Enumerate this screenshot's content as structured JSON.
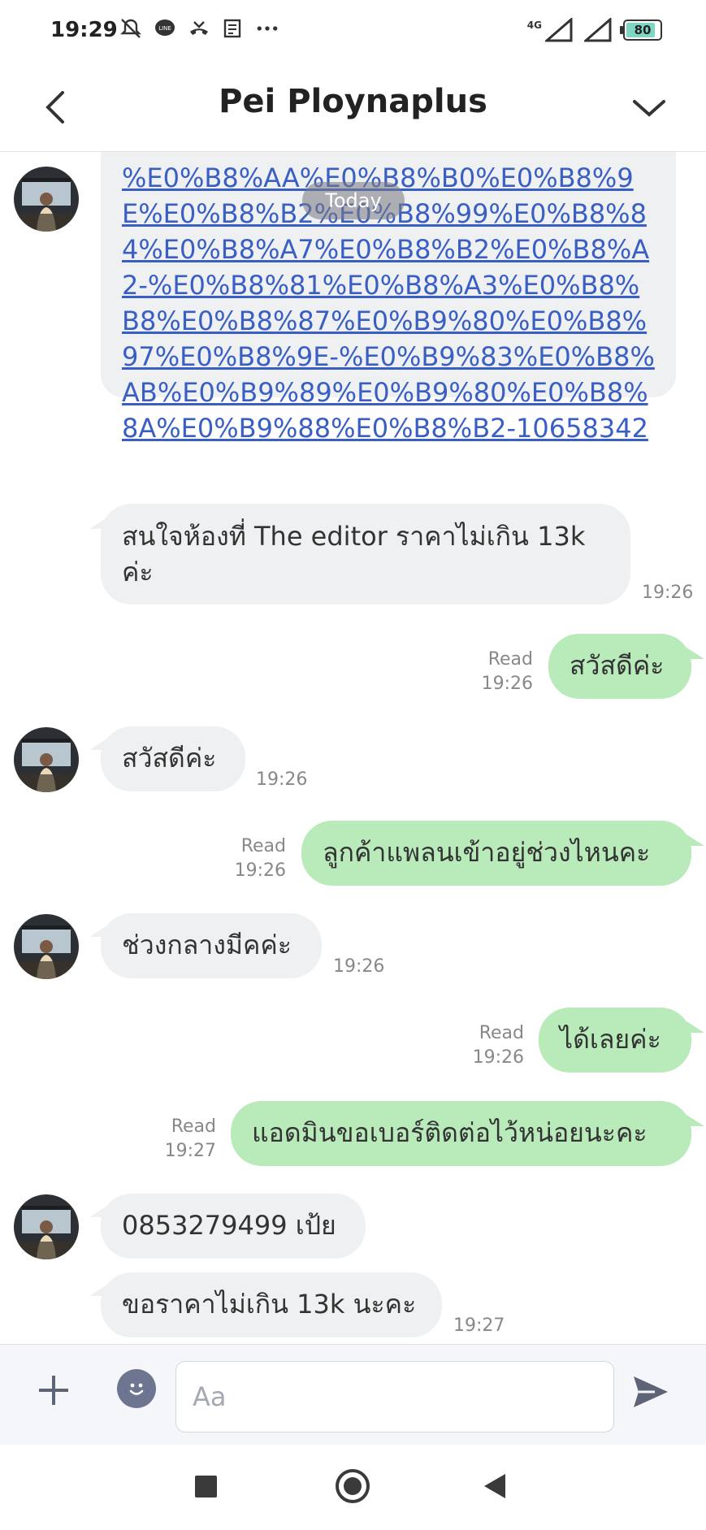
{
  "status_bar": {
    "time": "19:29",
    "network": "4G",
    "battery": "80",
    "icons": [
      "mute-icon",
      "line-icon",
      "missed-call-icon",
      "news-icon",
      "more-dots-icon"
    ]
  },
  "header": {
    "title": "Pei Ploynaplus",
    "back_icon": "chevron-left-icon",
    "menu_icon": "chevron-down-icon"
  },
  "chat": {
    "date_pill": "Today",
    "messages": [
      {
        "side": "in",
        "type": "link",
        "text": "%E0%B8%AA%E0%B8%B0%E0%B8%9E%E0%B8%B2%E0%B8%99%E0%B8%84%E0%B8%A7%E0%B8%B2%E0%B8%A2-%E0%B8%81%E0%B8%A3%E0%B8%B8%E0%B8%87%E0%B9%80%E0%B8%97%E0%B8%9E-%E0%B9%83%E0%B8%AB%E0%B9%89%E0%B9%80%E0%B8%8A%E0%B9%88%E0%B8%B2-10658342"
      },
      {
        "side": "in",
        "text": "สนใจห้องที่ The editor ราคาไม่เกิน 13k ค่ะ",
        "time": "19:26"
      },
      {
        "side": "out",
        "text": "สวัสดีค่ะ",
        "read": "Read",
        "time": "19:26"
      },
      {
        "side": "in",
        "text": "สวัสดีค่ะ",
        "time": "19:26"
      },
      {
        "side": "out",
        "text": "ลูกค้าแพลนเข้าอยู่ช่วงไหนคะ",
        "read": "Read",
        "time": "19:26"
      },
      {
        "side": "in",
        "text": "ช่วงกลางมีคค่ะ",
        "time": "19:26"
      },
      {
        "side": "out",
        "text": "ได้เลยค่ะ",
        "read": "Read",
        "time": "19:26"
      },
      {
        "side": "out",
        "text": "แอดมินขอเบอร์ติดต่อไว้หน่อยนะคะ",
        "read": "Read",
        "time": "19:27"
      },
      {
        "side": "in",
        "text": "0853279499 เป้ย"
      },
      {
        "side": "in",
        "text": "ขอราคาไม่เกิน 13k นะคะ",
        "time": "19:27"
      }
    ]
  },
  "input_bar": {
    "placeholder": "Aa",
    "value": "",
    "plus_icon": "plus-icon",
    "emoji_icon": "emoji-icon",
    "send_icon": "send-icon"
  },
  "nav_bar": {
    "recent_icon": "square-recent-icon",
    "home_icon": "home-circle-icon",
    "back_icon": "triangle-back-icon"
  },
  "colors": {
    "incoming_bubble": "#eef0f2",
    "outgoing_bubble": "#b9eaba",
    "link": "#3a5fc4"
  }
}
